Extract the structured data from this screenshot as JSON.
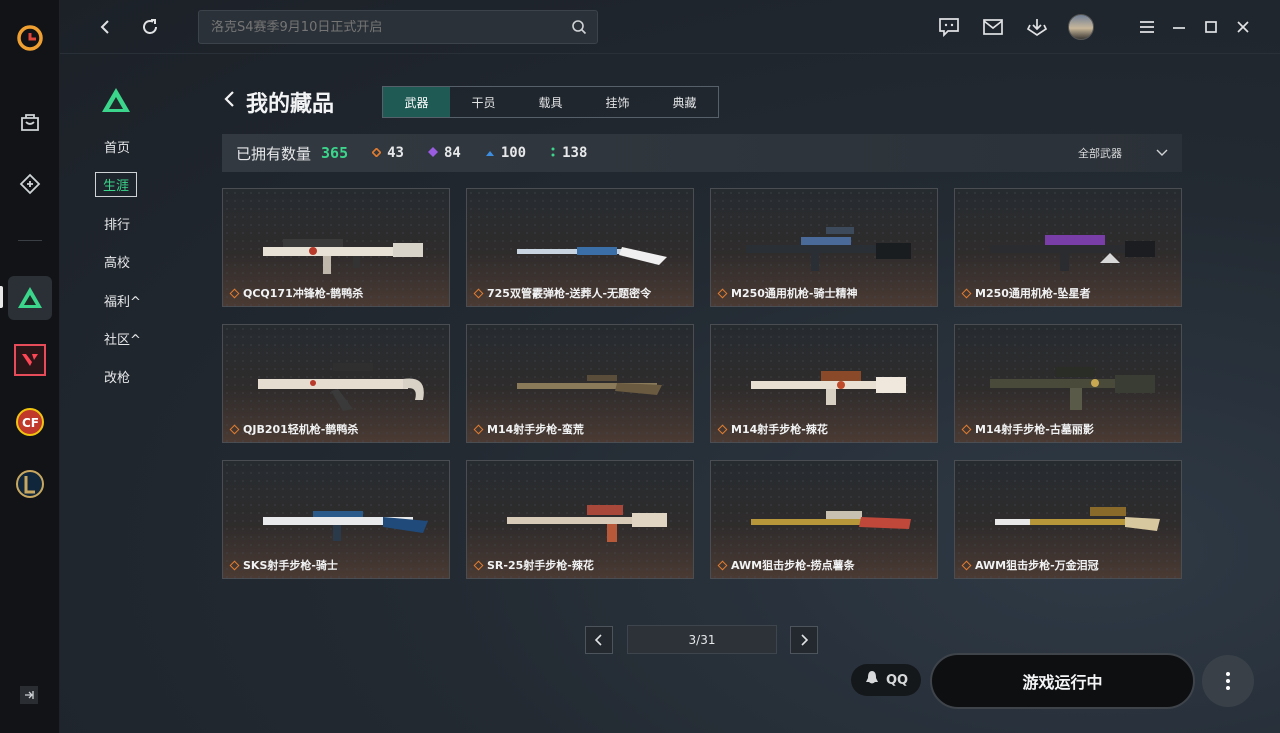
{
  "topbar": {
    "search_placeholder": "洛克S4赛季9月10日正式开启"
  },
  "subnav": {
    "items": [
      {
        "label": "首页"
      },
      {
        "label": "生涯"
      },
      {
        "label": "排行"
      },
      {
        "label": "高校"
      },
      {
        "label": "福利^"
      },
      {
        "label": "社区^"
      },
      {
        "label": "改枪"
      }
    ],
    "active_index": 1
  },
  "page": {
    "title": "我的藏品",
    "tabs": [
      "武器",
      "干员",
      "载具",
      "挂饰",
      "典藏"
    ],
    "active_tab": 0
  },
  "stats": {
    "label": "已拥有数量",
    "total": "365",
    "orange": "43",
    "purple": "84",
    "blue": "100",
    "green": "138",
    "filter": "全部武器",
    "colors": {
      "total": "#3bd58b",
      "orange": "#e07b2f",
      "purple": "#9a5ce0",
      "blue": "#3d8ee0",
      "green": "#3bd58b"
    }
  },
  "items": [
    {
      "name": "QCQ171冲锋枪-鹊鸭杀"
    },
    {
      "name": "725双管霰弹枪-送葬人-无题密令"
    },
    {
      "name": "M250通用机枪-骑士精神"
    },
    {
      "name": "M250通用机枪-坠星者"
    },
    {
      "name": "QJB201轻机枪-鹊鸭杀"
    },
    {
      "name": "M14射手步枪-蛮荒"
    },
    {
      "name": "M14射手步枪-辣花"
    },
    {
      "name": "M14射手步枪-古墓丽影"
    },
    {
      "name": "SKS射手步枪-骑士"
    },
    {
      "name": "SR-25射手步枪-辣花"
    },
    {
      "name": "AWM狙击步枪-捞点薯条"
    },
    {
      "name": "AWM狙击步枪-万金泪冠"
    }
  ],
  "pager": {
    "text": "3/31"
  },
  "bottom": {
    "qq": "QQ",
    "run": "游戏运行中"
  }
}
